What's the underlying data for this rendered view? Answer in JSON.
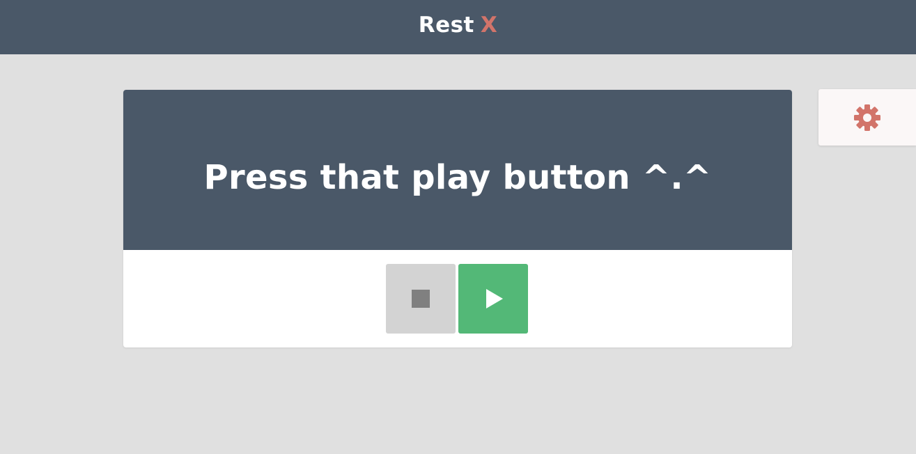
{
  "header": {
    "brand_text": "Rest",
    "brand_mark": "X",
    "brand_mark_color": "#d2746a",
    "background_color": "#4a5868"
  },
  "card": {
    "message": "Press that play button ^.^",
    "header_color": "#4a5868"
  },
  "controls": {
    "stop_icon": "stop-icon",
    "play_icon": "play-icon",
    "play_color": "#53b877",
    "stop_color": "#d3d3d3"
  },
  "settings": {
    "icon": "gear-icon",
    "icon_color": "#d2746a"
  }
}
